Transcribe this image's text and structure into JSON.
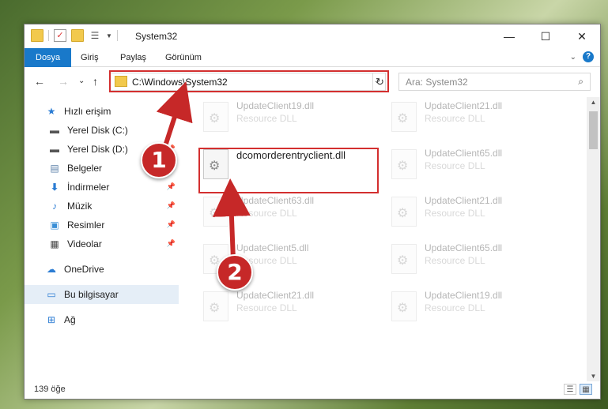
{
  "window": {
    "title": "System32",
    "controls": {
      "minimize": "—",
      "maximize": "☐",
      "close": "✕"
    }
  },
  "ribbon": {
    "tabs": [
      "Dosya",
      "Giriş",
      "Paylaş",
      "Görünüm"
    ],
    "help": "?"
  },
  "navigation": {
    "back": "←",
    "forward": "→",
    "recent": "⌄",
    "up": "↑",
    "address_path": "C:\\Windows\\System32",
    "refresh": "↻",
    "search_placeholder": "Ara: System32"
  },
  "sidebar": {
    "items": [
      {
        "label": "Hızlı erişim",
        "icon": "star-icon"
      },
      {
        "label": "Yerel Disk (C:)",
        "icon": "drive-icon",
        "pinned": true
      },
      {
        "label": "Yerel Disk (D:)",
        "icon": "drive-icon",
        "pinned": true
      },
      {
        "label": "Belgeler",
        "icon": "document-icon",
        "pinned": true
      },
      {
        "label": "İndirmeler",
        "icon": "download-icon",
        "pinned": true
      },
      {
        "label": "Müzik",
        "icon": "music-icon",
        "pinned": true
      },
      {
        "label": "Resimler",
        "icon": "pictures-icon",
        "pinned": true
      },
      {
        "label": "Videolar",
        "icon": "video-icon",
        "pinned": true
      },
      {
        "label": "OneDrive",
        "icon": "cloud-icon"
      },
      {
        "label": "Bu bilgisayar",
        "icon": "computer-icon",
        "selected": true
      },
      {
        "label": "Ağ",
        "icon": "network-icon"
      }
    ]
  },
  "files": [
    {
      "name": "UpdateClient19.dll",
      "type": "Resource DLL",
      "faded": true
    },
    {
      "name": "UpdateClient21.dll",
      "type": "Resource DLL",
      "faded": true
    },
    {
      "name": "dcomorderentryclient.dll",
      "type": "",
      "faded": false
    },
    {
      "name": "UpdateClient65.dll",
      "type": "Resource DLL",
      "faded": true
    },
    {
      "name": "UpdateClient63.dll",
      "type": "Resource DLL",
      "faded": true
    },
    {
      "name": "UpdateClient21.dll",
      "type": "Resource DLL",
      "faded": true
    },
    {
      "name": "UpdateClient5.dll",
      "type": "Resource DLL",
      "faded": true
    },
    {
      "name": "UpdateClient65.dll",
      "type": "Resource DLL",
      "faded": true
    },
    {
      "name": "UpdateClient21.dll",
      "type": "Resource DLL",
      "faded": true
    },
    {
      "name": "UpdateClient19.dll",
      "type": "Resource DLL",
      "faded": true
    }
  ],
  "status": {
    "item_count": "139 öğe"
  },
  "callouts": [
    "1",
    "2"
  ],
  "colors": {
    "accent": "#1979ca",
    "highlight": "#d32f2f",
    "callout": "#c62828"
  }
}
